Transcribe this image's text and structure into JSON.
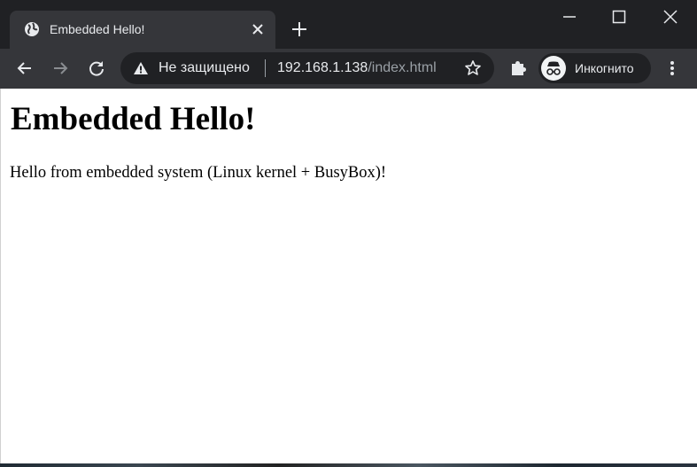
{
  "browser": {
    "tab": {
      "title": "Embedded Hello!",
      "favicon": "globe-icon"
    },
    "window_controls": [
      "minimize-icon",
      "maximize-icon",
      "close-icon"
    ],
    "omnibox": {
      "security_label": "Не защищено",
      "url_host": "192.168.1.138",
      "url_path": "/index.html"
    },
    "profile": {
      "label": "Инкогнито",
      "icon": "incognito-icon"
    },
    "colors": {
      "titlebar": "#202124",
      "toolbar": "#35363a",
      "text": "#e8eaed",
      "muted": "#9aa0a6"
    }
  },
  "page": {
    "heading": "Embedded Hello!",
    "paragraph": "Hello from embedded system (Linux kernel + BusyBox)!"
  }
}
